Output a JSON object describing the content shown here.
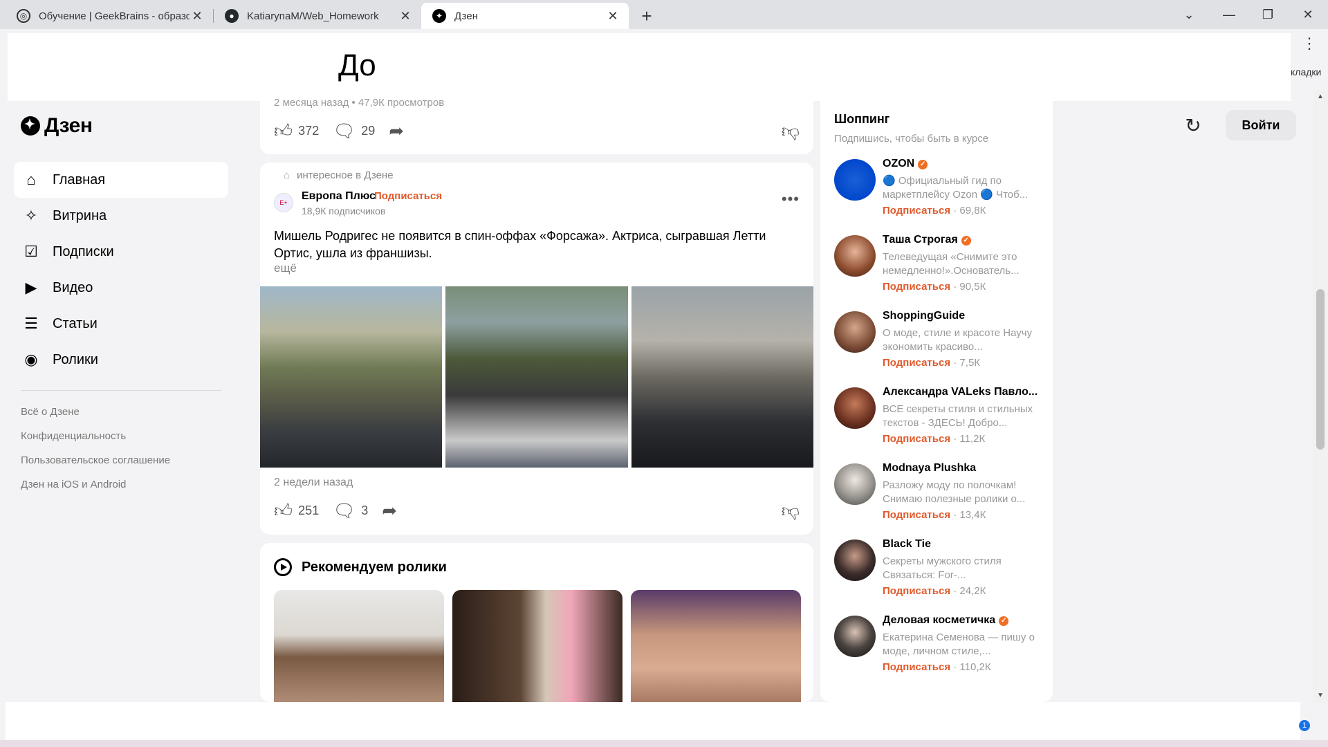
{
  "browser": {
    "tabs": [
      {
        "title": "Обучение | GeekBrains - образо",
        "icon": "geekbrains-icon"
      },
      {
        "title": "KatiarynaM/Web_Homework",
        "icon": "github-icon"
      },
      {
        "title": "Дзен",
        "icon": "dzen-icon"
      }
    ],
    "new_tab": "+",
    "bookmarks_tail": "кладки"
  },
  "overlay": {
    "text": "До"
  },
  "dzen": {
    "logo": "Дзен",
    "login": "Войти",
    "nav": [
      {
        "label": "Главная",
        "icon": "home-icon"
      },
      {
        "label": "Витрина",
        "icon": "sparkle-icon"
      },
      {
        "label": "Подписки",
        "icon": "subscriptions-icon"
      },
      {
        "label": "Видео",
        "icon": "video-icon"
      },
      {
        "label": "Статьи",
        "icon": "articles-icon"
      },
      {
        "label": "Ролики",
        "icon": "clips-icon"
      }
    ],
    "footer_links": [
      "Всё о Дзене",
      "Конфиденциальность",
      "Пользовательское соглашение",
      "Дзен на iOS и Android"
    ]
  },
  "feed": {
    "top_card": {
      "meta": "2 месяца назад • 47,9К просмотров",
      "likes": "372",
      "comments": "29"
    },
    "post": {
      "tag": "интересное в Дзене",
      "source": "Европа Плюс",
      "dot": "·",
      "subscribe": "Подписаться",
      "subscribers": "18,9К подписчиков",
      "text": "Мишель Родригес не появится в спин-оффах «Форсажа». Актриса, сыгравшая Летти Ортис, ушла из франшизы.",
      "more": "ещё",
      "time": "2 недели назад",
      "likes": "251",
      "comments": "3"
    },
    "reels": {
      "title": "Рекомендуем ролики"
    }
  },
  "sidebar": {
    "title": "Шоппинг",
    "subtitle": "Подпишись, чтобы быть в курсе",
    "channels": [
      {
        "name": "OZON",
        "verified": true,
        "desc": "🔵 Официальный гид по маркетплейсу Ozon 🔵 Чтоб...",
        "subscribe": "Подписаться",
        "count": "· 69,8К"
      },
      {
        "name": "Таша Строгая",
        "verified": true,
        "desc": "Телеведущая «Снимите это немедленно!».Основатель...",
        "subscribe": "Подписаться",
        "count": "· 90,5К"
      },
      {
        "name": "ShoppingGuide",
        "verified": false,
        "desc": "О моде, стиле и красоте Научу экономить красиво...",
        "subscribe": "Подписаться",
        "count": "· 7,5К"
      },
      {
        "name": "Александра VALeks Павло...",
        "verified": false,
        "desc": "ВСЕ секреты стиля и стильных текстов - ЗДЕСЬ! Добро...",
        "subscribe": "Подписаться",
        "count": "· 11,2К"
      },
      {
        "name": "Modnaya Plushka",
        "verified": false,
        "desc": "Разложу моду по полочкам! Снимаю полезные ролики о...",
        "subscribe": "Подписаться",
        "count": "· 13,4К"
      },
      {
        "name": "Black Tie",
        "verified": false,
        "desc": "Секреты мужского стиля Связаться: For-...",
        "subscribe": "Подписаться",
        "count": "· 24,2К"
      },
      {
        "name": "Деловая косметичка",
        "verified": true,
        "desc": "Екатерина Семенова — пишу о моде, личном стиле,...",
        "subscribe": "Подписаться",
        "count": "· 110,2К"
      }
    ]
  },
  "taskbar": {
    "badge": "1"
  },
  "colors": {
    "accent": "#e05a2b",
    "verified": "#f26d21"
  }
}
